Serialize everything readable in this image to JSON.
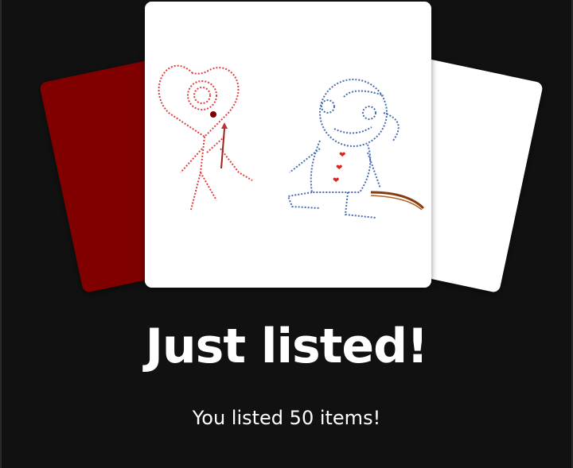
{
  "header": {
    "title": "Just listed!",
    "subtitle": "You listed 50 items!"
  },
  "cards": [
    {
      "name": "listing-card-back-left",
      "color": "#800000"
    },
    {
      "name": "listing-card-front",
      "color": "#ffffff"
    },
    {
      "name": "listing-card-back-right",
      "color": "#ffffff"
    }
  ],
  "theme": {
    "background": "#111111",
    "text": "#ffffff"
  }
}
